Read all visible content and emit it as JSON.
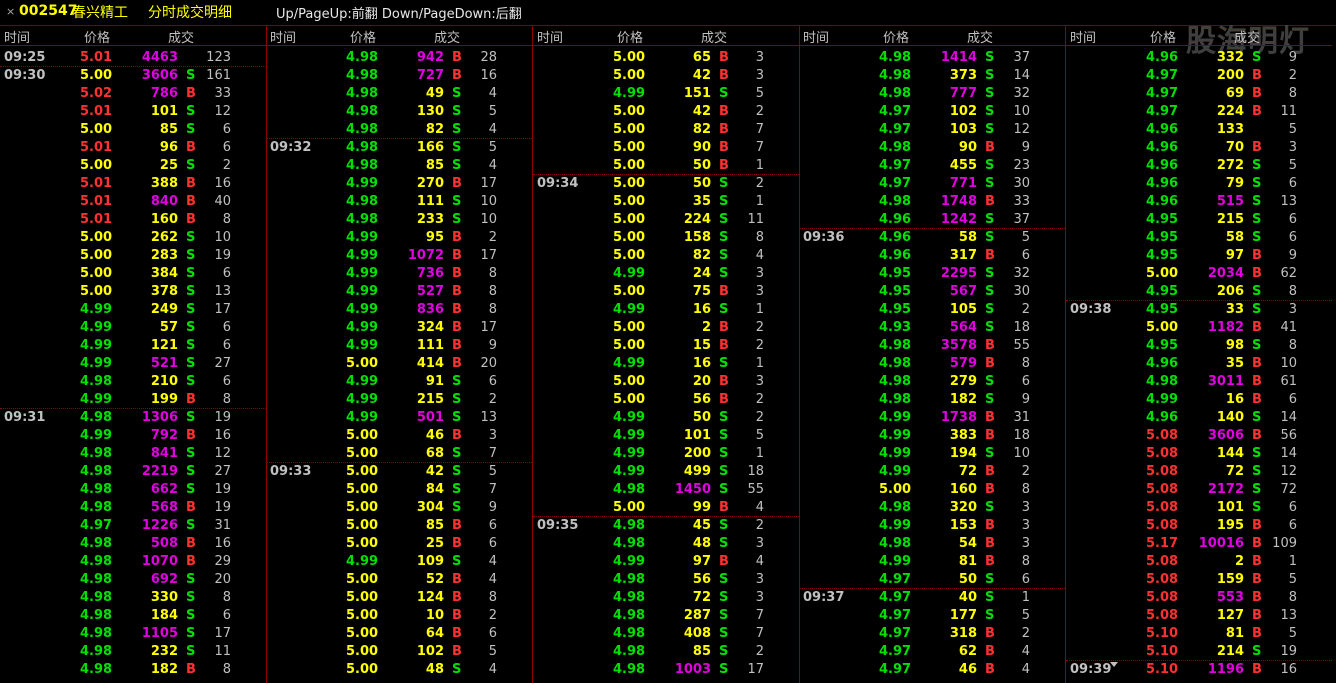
{
  "window": {
    "close": "×",
    "code": "002547",
    "name": "春兴精工",
    "title": "分时成交明细",
    "hint": "Up/PageUp:前翻 Down/PageDown:后翻",
    "watermark": "股海明灯"
  },
  "headers": {
    "time": "时间",
    "price": "价格",
    "volume": "成交"
  },
  "colors": {
    "up": "#ff3030",
    "down": "#00e000",
    "flat": "#ffff00",
    "large": "#e000e0",
    "buy": "#ff3030",
    "sell": "#00e000",
    "grid": "#8b0000"
  },
  "prev_close": 5.0,
  "large_threshold": 500,
  "columns": [
    [
      [
        "09:25",
        "5.01",
        4463,
        "",
        123
      ],
      [
        "09:30",
        "5.00",
        3606,
        "S",
        161
      ],
      [
        "",
        "5.02",
        786,
        "B",
        33
      ],
      [
        "",
        "5.01",
        101,
        "S",
        12
      ],
      [
        "",
        "5.00",
        85,
        "S",
        6
      ],
      [
        "",
        "5.01",
        96,
        "B",
        6
      ],
      [
        "",
        "5.00",
        25,
        "S",
        2
      ],
      [
        "",
        "5.01",
        388,
        "B",
        16
      ],
      [
        "",
        "5.01",
        840,
        "B",
        40
      ],
      [
        "",
        "5.01",
        160,
        "B",
        8
      ],
      [
        "",
        "5.00",
        262,
        "S",
        10
      ],
      [
        "",
        "5.00",
        283,
        "S",
        19
      ],
      [
        "",
        "5.00",
        384,
        "S",
        6
      ],
      [
        "",
        "5.00",
        378,
        "S",
        13
      ],
      [
        "",
        "4.99",
        249,
        "S",
        17
      ],
      [
        "",
        "4.99",
        57,
        "S",
        6
      ],
      [
        "",
        "4.99",
        121,
        "S",
        6
      ],
      [
        "",
        "4.99",
        521,
        "S",
        27
      ],
      [
        "",
        "4.98",
        210,
        "S",
        6
      ],
      [
        "",
        "4.99",
        199,
        "B",
        8
      ],
      [
        "09:31",
        "4.98",
        1306,
        "S",
        19
      ],
      [
        "",
        "4.99",
        792,
        "B",
        16
      ],
      [
        "",
        "4.98",
        841,
        "S",
        12
      ],
      [
        "",
        "4.98",
        2219,
        "S",
        27
      ],
      [
        "",
        "4.98",
        662,
        "S",
        19
      ],
      [
        "",
        "4.98",
        568,
        "B",
        19
      ],
      [
        "",
        "4.97",
        1226,
        "S",
        31
      ],
      [
        "",
        "4.98",
        508,
        "B",
        16
      ],
      [
        "",
        "4.98",
        1070,
        "B",
        29
      ],
      [
        "",
        "4.98",
        692,
        "S",
        20
      ],
      [
        "",
        "4.98",
        330,
        "S",
        8
      ],
      [
        "",
        "4.98",
        184,
        "S",
        6
      ],
      [
        "",
        "4.98",
        1105,
        "S",
        17
      ],
      [
        "",
        "4.98",
        232,
        "S",
        11
      ],
      [
        "",
        "4.98",
        182,
        "B",
        8
      ]
    ],
    [
      [
        "",
        "4.98",
        942,
        "B",
        28
      ],
      [
        "",
        "4.98",
        727,
        "B",
        16
      ],
      [
        "",
        "4.98",
        49,
        "S",
        4
      ],
      [
        "",
        "4.98",
        130,
        "S",
        5
      ],
      [
        "",
        "4.98",
        82,
        "S",
        4
      ],
      [
        "09:32",
        "4.98",
        166,
        "S",
        5
      ],
      [
        "",
        "4.98",
        85,
        "S",
        4
      ],
      [
        "",
        "4.99",
        270,
        "B",
        17
      ],
      [
        "",
        "4.98",
        111,
        "S",
        10
      ],
      [
        "",
        "4.98",
        233,
        "S",
        10
      ],
      [
        "",
        "4.99",
        95,
        "B",
        2
      ],
      [
        "",
        "4.99",
        1072,
        "B",
        17
      ],
      [
        "",
        "4.99",
        736,
        "B",
        8
      ],
      [
        "",
        "4.99",
        527,
        "B",
        8
      ],
      [
        "",
        "4.99",
        836,
        "B",
        8
      ],
      [
        "",
        "4.99",
        324,
        "B",
        17
      ],
      [
        "",
        "4.99",
        111,
        "B",
        9
      ],
      [
        "",
        "5.00",
        414,
        "B",
        20
      ],
      [
        "",
        "4.99",
        91,
        "S",
        6
      ],
      [
        "",
        "4.99",
        215,
        "S",
        2
      ],
      [
        "",
        "4.99",
        501,
        "S",
        13
      ],
      [
        "",
        "5.00",
        46,
        "B",
        3
      ],
      [
        "",
        "5.00",
        68,
        "S",
        7
      ],
      [
        "09:33",
        "5.00",
        42,
        "S",
        5
      ],
      [
        "",
        "5.00",
        84,
        "S",
        7
      ],
      [
        "",
        "5.00",
        304,
        "S",
        9
      ],
      [
        "",
        "5.00",
        85,
        "B",
        6
      ],
      [
        "",
        "5.00",
        25,
        "B",
        6
      ],
      [
        "",
        "4.99",
        109,
        "S",
        4
      ],
      [
        "",
        "5.00",
        52,
        "B",
        4
      ],
      [
        "",
        "5.00",
        124,
        "B",
        8
      ],
      [
        "",
        "5.00",
        10,
        "B",
        2
      ],
      [
        "",
        "5.00",
        64,
        "B",
        6
      ],
      [
        "",
        "5.00",
        102,
        "B",
        5
      ],
      [
        "",
        "5.00",
        48,
        "S",
        4
      ]
    ],
    [
      [
        "",
        "5.00",
        65,
        "B",
        3
      ],
      [
        "",
        "5.00",
        42,
        "B",
        3
      ],
      [
        "",
        "4.99",
        151,
        "S",
        5
      ],
      [
        "",
        "5.00",
        42,
        "B",
        2
      ],
      [
        "",
        "5.00",
        82,
        "B",
        7
      ],
      [
        "",
        "5.00",
        90,
        "B",
        7
      ],
      [
        "",
        "5.00",
        50,
        "B",
        1
      ],
      [
        "09:34",
        "5.00",
        50,
        "S",
        2
      ],
      [
        "",
        "5.00",
        35,
        "S",
        1
      ],
      [
        "",
        "5.00",
        224,
        "S",
        11
      ],
      [
        "",
        "5.00",
        158,
        "S",
        8
      ],
      [
        "",
        "5.00",
        82,
        "S",
        4
      ],
      [
        "",
        "4.99",
        24,
        "S",
        3
      ],
      [
        "",
        "5.00",
        75,
        "B",
        3
      ],
      [
        "",
        "4.99",
        16,
        "S",
        1
      ],
      [
        "",
        "5.00",
        2,
        "B",
        2
      ],
      [
        "",
        "5.00",
        15,
        "B",
        2
      ],
      [
        "",
        "4.99",
        16,
        "S",
        1
      ],
      [
        "",
        "5.00",
        20,
        "B",
        3
      ],
      [
        "",
        "5.00",
        56,
        "B",
        2
      ],
      [
        "",
        "4.99",
        50,
        "S",
        2
      ],
      [
        "",
        "4.99",
        101,
        "S",
        5
      ],
      [
        "",
        "4.99",
        200,
        "S",
        1
      ],
      [
        "",
        "4.99",
        499,
        "S",
        18
      ],
      [
        "",
        "4.98",
        1450,
        "S",
        55
      ],
      [
        "",
        "5.00",
        99,
        "B",
        4
      ],
      [
        "09:35",
        "4.98",
        45,
        "S",
        2
      ],
      [
        "",
        "4.98",
        48,
        "S",
        3
      ],
      [
        "",
        "4.99",
        97,
        "B",
        4
      ],
      [
        "",
        "4.98",
        56,
        "S",
        3
      ],
      [
        "",
        "4.98",
        72,
        "S",
        3
      ],
      [
        "",
        "4.98",
        287,
        "S",
        7
      ],
      [
        "",
        "4.98",
        408,
        "S",
        7
      ],
      [
        "",
        "4.98",
        85,
        "S",
        2
      ],
      [
        "",
        "4.98",
        1003,
        "S",
        17
      ]
    ],
    [
      [
        "",
        "4.98",
        1414,
        "S",
        37
      ],
      [
        "",
        "4.98",
        373,
        "S",
        14
      ],
      [
        "",
        "4.98",
        777,
        "S",
        32
      ],
      [
        "",
        "4.97",
        102,
        "S",
        10
      ],
      [
        "",
        "4.97",
        103,
        "S",
        12
      ],
      [
        "",
        "4.98",
        90,
        "B",
        9
      ],
      [
        "",
        "4.97",
        455,
        "S",
        23
      ],
      [
        "",
        "4.97",
        771,
        "S",
        30
      ],
      [
        "",
        "4.98",
        1748,
        "B",
        33
      ],
      [
        "",
        "4.96",
        1242,
        "S",
        37
      ],
      [
        "09:36",
        "4.96",
        58,
        "S",
        5
      ],
      [
        "",
        "4.96",
        317,
        "B",
        6
      ],
      [
        "",
        "4.95",
        2295,
        "S",
        32
      ],
      [
        "",
        "4.95",
        567,
        "S",
        30
      ],
      [
        "",
        "4.95",
        105,
        "S",
        2
      ],
      [
        "",
        "4.93",
        564,
        "S",
        18
      ],
      [
        "",
        "4.98",
        3578,
        "B",
        55
      ],
      [
        "",
        "4.98",
        579,
        "B",
        8
      ],
      [
        "",
        "4.98",
        279,
        "S",
        6
      ],
      [
        "",
        "4.98",
        182,
        "S",
        9
      ],
      [
        "",
        "4.99",
        1738,
        "B",
        31
      ],
      [
        "",
        "4.99",
        383,
        "B",
        18
      ],
      [
        "",
        "4.99",
        194,
        "S",
        10
      ],
      [
        "",
        "4.99",
        72,
        "B",
        2
      ],
      [
        "",
        "5.00",
        160,
        "B",
        8
      ],
      [
        "",
        "4.98",
        320,
        "S",
        3
      ],
      [
        "",
        "4.99",
        153,
        "B",
        3
      ],
      [
        "",
        "4.98",
        54,
        "B",
        3
      ],
      [
        "",
        "4.99",
        81,
        "B",
        8
      ],
      [
        "",
        "4.97",
        50,
        "S",
        6
      ],
      [
        "09:37",
        "4.97",
        40,
        "S",
        1
      ],
      [
        "",
        "4.97",
        177,
        "S",
        5
      ],
      [
        "",
        "4.97",
        318,
        "B",
        2
      ],
      [
        "",
        "4.97",
        62,
        "B",
        4
      ],
      [
        "",
        "4.97",
        46,
        "B",
        4
      ]
    ],
    [
      [
        "",
        "4.96",
        332,
        "S",
        9
      ],
      [
        "",
        "4.97",
        200,
        "B",
        2
      ],
      [
        "",
        "4.97",
        69,
        "B",
        8
      ],
      [
        "",
        "4.97",
        224,
        "B",
        11
      ],
      [
        "",
        "4.96",
        133,
        "",
        5
      ],
      [
        "",
        "4.96",
        70,
        "B",
        3
      ],
      [
        "",
        "4.96",
        272,
        "S",
        5
      ],
      [
        "",
        "4.96",
        79,
        "S",
        6
      ],
      [
        "",
        "4.96",
        515,
        "S",
        13
      ],
      [
        "",
        "4.95",
        215,
        "S",
        6
      ],
      [
        "",
        "4.95",
        58,
        "S",
        6
      ],
      [
        "",
        "4.95",
        97,
        "B",
        9
      ],
      [
        "",
        "5.00",
        2034,
        "B",
        62
      ],
      [
        "",
        "4.95",
        206,
        "S",
        8
      ],
      [
        "09:38",
        "4.95",
        33,
        "S",
        3
      ],
      [
        "",
        "5.00",
        1182,
        "B",
        41
      ],
      [
        "",
        "4.95",
        98,
        "S",
        8
      ],
      [
        "",
        "4.96",
        35,
        "B",
        10
      ],
      [
        "",
        "4.98",
        3011,
        "B",
        61
      ],
      [
        "",
        "4.99",
        16,
        "B",
        6
      ],
      [
        "",
        "4.96",
        140,
        "S",
        14
      ],
      [
        "",
        "5.08",
        3606,
        "B",
        56
      ],
      [
        "",
        "5.08",
        144,
        "S",
        14
      ],
      [
        "",
        "5.08",
        72,
        "S",
        12
      ],
      [
        "",
        "5.08",
        2172,
        "S",
        72
      ],
      [
        "",
        "5.08",
        101,
        "S",
        6
      ],
      [
        "",
        "5.08",
        195,
        "B",
        6
      ],
      [
        "",
        "5.17",
        10016,
        "B",
        109
      ],
      [
        "",
        "5.08",
        2,
        "B",
        1
      ],
      [
        "",
        "5.08",
        159,
        "B",
        5
      ],
      [
        "",
        "5.08",
        553,
        "B",
        8
      ],
      [
        "",
        "5.08",
        127,
        "B",
        13
      ],
      [
        "",
        "5.10",
        81,
        "B",
        5
      ],
      [
        "",
        "5.10",
        214,
        "S",
        19
      ],
      [
        "09:39",
        "5.10",
        1196,
        "B",
        16
      ]
    ]
  ]
}
